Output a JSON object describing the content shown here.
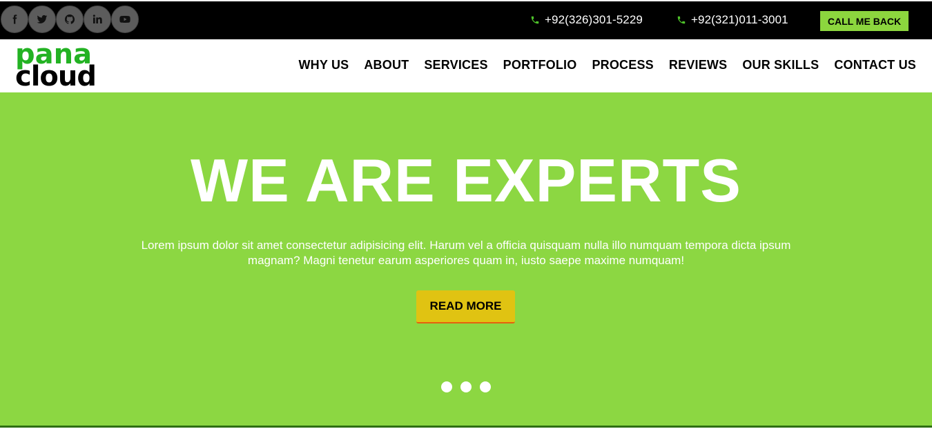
{
  "topbar": {
    "social": [
      {
        "icon": "facebook-icon"
      },
      {
        "icon": "twitter-icon"
      },
      {
        "icon": "github-icon"
      },
      {
        "icon": "linkedin-icon"
      },
      {
        "icon": "youtube-icon"
      }
    ],
    "phone1": "+92(326)301-5229",
    "phone2": "+92(321)011-3001",
    "callback_label": "CALL ME BACK"
  },
  "header": {
    "logo_top": "pana",
    "logo_bottom": "cloud",
    "nav": [
      "WHY US",
      "ABOUT",
      "SERVICES",
      "PORTFOLIO",
      "PROCESS",
      "REVIEWS",
      "OUR SKILLS",
      "CONTACT US"
    ]
  },
  "hero": {
    "title": "WE ARE EXPERTS",
    "text": "Lorem ipsum dolor sit amet consectetur adipisicing elit. Harum vel a officia quisquam nulla illo numquam tempora dicta ipsum magnam? Magni tenetur earum asperiores quam in, iusto saepe maxime numquam!",
    "button_label": "READ MORE",
    "slide_count": 3
  },
  "colors": {
    "accent_green": "#8cd742",
    "logo_green": "#23b223",
    "button_yellow": "#e0c312",
    "topbar": "#000000"
  }
}
